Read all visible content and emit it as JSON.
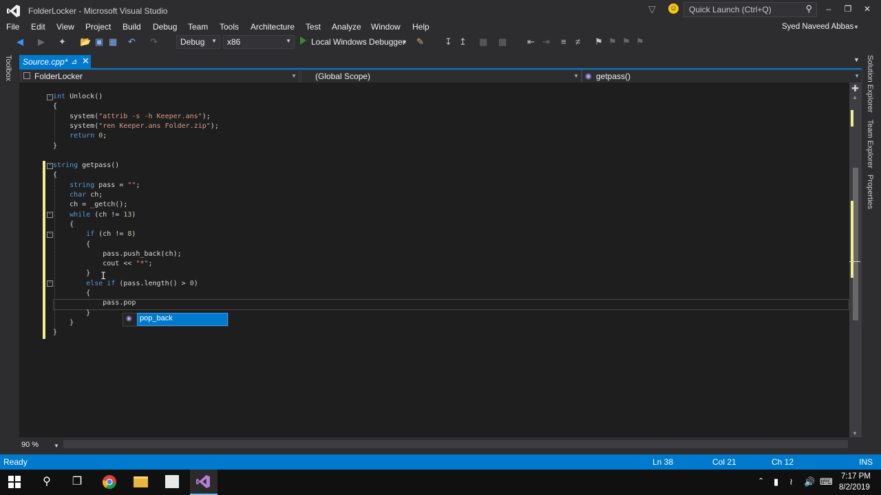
{
  "window": {
    "title": "FolderLocker - Microsoft Visual Studio",
    "quick_launch_placeholder": "Quick Launch (Ctrl+Q)",
    "minimize": "–",
    "restore": "❐",
    "close": "✕"
  },
  "menu": {
    "items": [
      "File",
      "Edit",
      "View",
      "Project",
      "Build",
      "Debug",
      "Team",
      "Tools",
      "Architecture",
      "Test",
      "Analyze",
      "Window",
      "Help"
    ],
    "user": "Syed Naveed Abbas"
  },
  "toolbar": {
    "configuration": "Debug",
    "platform": "x86",
    "run_label": "Local Windows Debugger"
  },
  "side_panels": {
    "left": "Toolbox",
    "right": [
      "Solution Explorer",
      "Team Explorer",
      "Properties"
    ]
  },
  "document": {
    "tab_label": "Source.cpp*"
  },
  "navbar": {
    "project": "FolderLocker",
    "scope": "(Global Scope)",
    "member": "getpass()"
  },
  "code": {
    "lines": [
      [
        {
          "t": "int",
          "c": "kw"
        },
        {
          "t": " Unlock()"
        }
      ],
      [
        {
          "t": "{"
        }
      ],
      [
        {
          "t": "    system("
        },
        {
          "t": "\"attrib -s -h Keeper.ans\"",
          "c": "str"
        },
        {
          "t": ");"
        }
      ],
      [
        {
          "t": "    system("
        },
        {
          "t": "\"ren Keeper.ans Folder.zip\"",
          "c": "str"
        },
        {
          "t": ");"
        }
      ],
      [
        {
          "t": "    "
        },
        {
          "t": "return",
          "c": "kw"
        },
        {
          "t": " "
        },
        {
          "t": "0",
          "c": "num"
        },
        {
          "t": ";"
        }
      ],
      [
        {
          "t": "}"
        }
      ],
      [
        {
          "t": ""
        }
      ],
      [
        {
          "t": "string",
          "c": "kw"
        },
        {
          "t": " getpass()"
        }
      ],
      [
        {
          "t": "{"
        }
      ],
      [
        {
          "t": "    "
        },
        {
          "t": "string",
          "c": "kw"
        },
        {
          "t": " pass = "
        },
        {
          "t": "\"\"",
          "c": "str"
        },
        {
          "t": ";"
        }
      ],
      [
        {
          "t": "    "
        },
        {
          "t": "char",
          "c": "kw"
        },
        {
          "t": " ch;"
        }
      ],
      [
        {
          "t": "    ch = _getch();"
        }
      ],
      [
        {
          "t": "    "
        },
        {
          "t": "while",
          "c": "kw"
        },
        {
          "t": " (ch != "
        },
        {
          "t": "13",
          "c": "num"
        },
        {
          "t": ")"
        }
      ],
      [
        {
          "t": "    {"
        }
      ],
      [
        {
          "t": "        "
        },
        {
          "t": "if",
          "c": "kw"
        },
        {
          "t": " (ch != "
        },
        {
          "t": "8",
          "c": "num"
        },
        {
          "t": ")"
        }
      ],
      [
        {
          "t": "        {"
        }
      ],
      [
        {
          "t": "            pass.push_back(ch);"
        }
      ],
      [
        {
          "t": "            cout << "
        },
        {
          "t": "\"*\"",
          "c": "str"
        },
        {
          "t": ";"
        }
      ],
      [
        {
          "t": "        }"
        }
      ],
      [
        {
          "t": "        "
        },
        {
          "t": "else",
          "c": "kw"
        },
        {
          "t": " "
        },
        {
          "t": "if",
          "c": "kw"
        },
        {
          "t": " (pass.length() > "
        },
        {
          "t": "0",
          "c": "num"
        },
        {
          "t": ")"
        }
      ],
      [
        {
          "t": "        {"
        }
      ],
      [
        {
          "t": "            pass.pop"
        }
      ],
      [
        {
          "t": "        }"
        }
      ],
      [
        {
          "t": "    }"
        }
      ],
      [
        {
          "t": "}"
        }
      ]
    ]
  },
  "autocomplete": {
    "item": "pop_back"
  },
  "editor": {
    "zoom": "90 %"
  },
  "status": {
    "state": "Ready",
    "line": "Ln 38",
    "col": "Col 21",
    "ch": "Ch 12",
    "mode": "INS"
  },
  "taskbar": {
    "time": "7:17 PM",
    "date": "8/2/2019"
  },
  "colors": {
    "accent": "#007acc",
    "editor_bg": "#1e1e1e",
    "keyword": "#569cd6",
    "string": "#d69d85",
    "change_marker": "#efef91"
  }
}
